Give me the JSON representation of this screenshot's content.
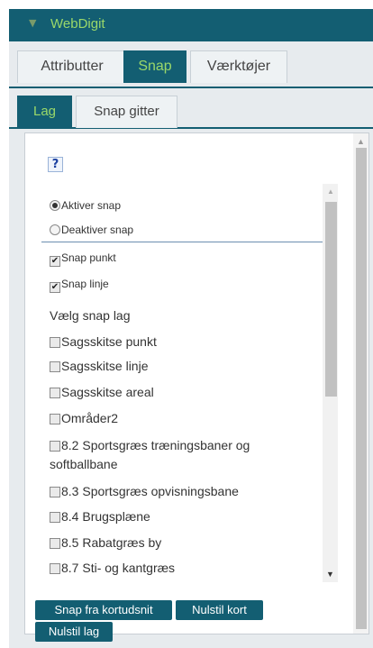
{
  "header": {
    "title": "WebDigit"
  },
  "main_tabs": [
    {
      "label": "Attributter"
    },
    {
      "label": "Snap"
    },
    {
      "label": "Værktøjer"
    }
  ],
  "sub_tabs": [
    {
      "label": "Lag"
    },
    {
      "label": "Snap gitter"
    }
  ],
  "snap_mode": [
    {
      "label": "Aktiver snap",
      "selected": true
    },
    {
      "label": "Deaktiver snap",
      "selected": false
    }
  ],
  "snap_types": [
    {
      "label": "Snap punkt",
      "checked": true
    },
    {
      "label": "Snap linje",
      "checked": true
    }
  ],
  "layers_heading": "Vælg snap lag",
  "layers": [
    {
      "label": "Sagsskitse punkt",
      "checked": false
    },
    {
      "label": "Sagsskitse linje",
      "checked": false
    },
    {
      "label": "Sagsskitse areal",
      "checked": false
    },
    {
      "label": "Områder2",
      "checked": false
    },
    {
      "label": "8.2 Sportsgræs træningsbaner og softballbane",
      "checked": false
    },
    {
      "label": "8.3 Sportsgræs opvisningsbane",
      "checked": false
    },
    {
      "label": "8.4 Brugsplæne",
      "checked": false
    },
    {
      "label": "8.5 Rabatgræs by",
      "checked": false
    },
    {
      "label": "8.7 Sti- og kantgræs",
      "checked": false
    }
  ],
  "buttons": {
    "snap_from_map": "Snap fra kortudsnit",
    "reset_map": "Nulstil kort",
    "reset_layers": "Nulstil lag"
  },
  "colors": {
    "accent": "#135e72",
    "active_text": "#9ad86a",
    "tab_bg": "#e7ebee"
  }
}
